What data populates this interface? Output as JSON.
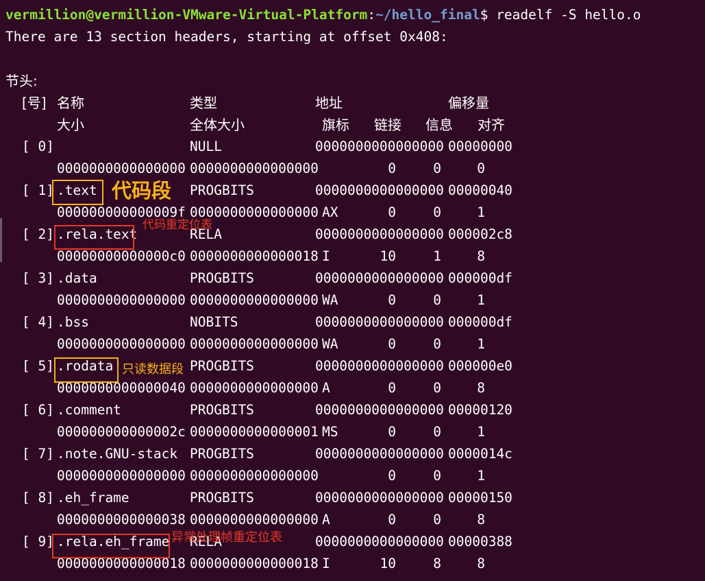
{
  "terminal": {
    "prompt_user_host": "vermillion@vermillion-VMware-Virtual-Platform",
    "prompt_separator": ":",
    "prompt_path": "~/hello_final",
    "prompt_symbol": "$",
    "command": " readelf -S hello.o",
    "summary_line": "There are 13 section headers, starting at offset 0x408:",
    "section_title": "节头:",
    "header_row1": {
      "nr": "[号]",
      "name": "名称",
      "type": "类型",
      "address": "地址",
      "offset": "偏移量"
    },
    "header_row2": {
      "size": "大小",
      "entsize": "全体大小",
      "flags": "旗标",
      "link": "链接",
      "info": "信息",
      "align": "对齐"
    },
    "sections": [
      {
        "nr": "[ 0]",
        "name": "",
        "type": "NULL",
        "address": "0000000000000000",
        "offset": "00000000",
        "size": "0000000000000000",
        "entsize": "0000000000000000",
        "flags": "",
        "link": "0",
        "info": "0",
        "align": "0"
      },
      {
        "nr": "[ 1]",
        "name": ".text",
        "type": "PROGBITS",
        "address": "0000000000000000",
        "offset": "00000040",
        "size": "000000000000009f",
        "entsize": "0000000000000000",
        "flags": "AX",
        "link": "0",
        "info": "0",
        "align": "1"
      },
      {
        "nr": "[ 2]",
        "name": ".rela.text",
        "type": "RELA",
        "address": "0000000000000000",
        "offset": "000002c8",
        "size": "00000000000000c0",
        "entsize": "0000000000000018",
        "flags": "I",
        "link": "10",
        "info": "1",
        "align": "8"
      },
      {
        "nr": "[ 3]",
        "name": ".data",
        "type": "PROGBITS",
        "address": "0000000000000000",
        "offset": "000000df",
        "size": "0000000000000000",
        "entsize": "0000000000000000",
        "flags": "WA",
        "link": "0",
        "info": "0",
        "align": "1"
      },
      {
        "nr": "[ 4]",
        "name": ".bss",
        "type": "NOBITS",
        "address": "0000000000000000",
        "offset": "000000df",
        "size": "0000000000000000",
        "entsize": "0000000000000000",
        "flags": "WA",
        "link": "0",
        "info": "0",
        "align": "1"
      },
      {
        "nr": "[ 5]",
        "name": ".rodata",
        "type": "PROGBITS",
        "address": "0000000000000000",
        "offset": "000000e0",
        "size": "0000000000000040",
        "entsize": "0000000000000000",
        "flags": "A",
        "link": "0",
        "info": "0",
        "align": "8"
      },
      {
        "nr": "[ 6]",
        "name": ".comment",
        "type": "PROGBITS",
        "address": "0000000000000000",
        "offset": "00000120",
        "size": "000000000000002c",
        "entsize": "0000000000000001",
        "flags": "MS",
        "link": "0",
        "info": "0",
        "align": "1"
      },
      {
        "nr": "[ 7]",
        "name": ".note.GNU-stack",
        "type": "PROGBITS",
        "address": "0000000000000000",
        "offset": "0000014c",
        "size": "0000000000000000",
        "entsize": "0000000000000000",
        "flags": "",
        "link": "0",
        "info": "0",
        "align": "1"
      },
      {
        "nr": "[ 8]",
        "name": ".eh_frame",
        "type": "PROGBITS",
        "address": "0000000000000000",
        "offset": "00000150",
        "size": "0000000000000038",
        "entsize": "0000000000000000",
        "flags": "A",
        "link": "0",
        "info": "0",
        "align": "8"
      },
      {
        "nr": "[ 9]",
        "name": ".rela.eh_frame",
        "type": "RELA",
        "address": "0000000000000000",
        "offset": "00000388",
        "size": "0000000000000018",
        "entsize": "0000000000000018",
        "flags": "I",
        "link": "10",
        "info": "8",
        "align": "8"
      }
    ]
  },
  "annotations": {
    "text_label": "代码段",
    "rela_text_label": "代码重定位表",
    "rodata_label": "只读数据段",
    "rela_eh_frame_label": "异常处理帧重定位表"
  },
  "colors": {
    "background": "#300a24",
    "prompt_user": "#8ae234",
    "prompt_path": "#729fcf",
    "annotation_orange": "#f6b31b",
    "annotation_red": "#e53925"
  }
}
